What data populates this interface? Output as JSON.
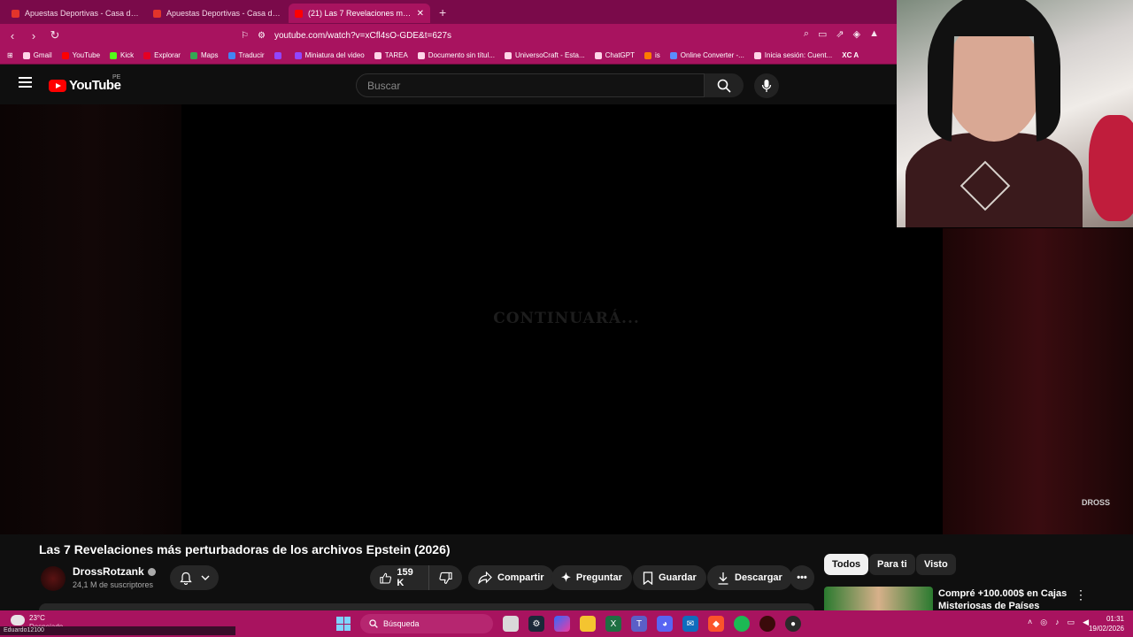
{
  "browser": {
    "tabs": [
      {
        "title": "Apuestas Deportivas - Casa de Apuestas",
        "active": false
      },
      {
        "title": "Apuestas Deportivas - Casa de Apuestas",
        "active": false
      },
      {
        "title": "(21) Las 7 Revelaciones más perturbadoras",
        "active": true
      }
    ],
    "url": "youtube.com/watch?v=xCfl4sO-GDE&t=627s",
    "bookmarks": [
      "Gmail",
      "YouTube",
      "Kick",
      "Explorar",
      "Maps",
      "Traducir",
      "",
      "Miniatura del video",
      "TAREA",
      "Documento sin títul...",
      "UniversoCraft - Esta...",
      "ChatGPT",
      "is",
      "Online Converter -...",
      "Inicia sesión: Cuent...",
      "XC A"
    ]
  },
  "youtube": {
    "logo_text": "YouTube",
    "country_code": "PE",
    "search_placeholder": "Buscar"
  },
  "player": {
    "overlay_text": "CONTINUARÁ...",
    "watermark": "DROSS"
  },
  "video": {
    "title": "Las 7 Revelaciones más perturbadoras de los archivos Epstein (2026)",
    "channel": "DrossRotzank",
    "subscribers": "24,1 M de suscriptores",
    "likes": "159 K",
    "share_label": "Compartir",
    "ask_label": "Preguntar",
    "save_label": "Guardar",
    "download_label": "Descargar"
  },
  "chips": [
    "Todos",
    "Para ti",
    "Visto"
  ],
  "recommendation": {
    "title": "Compré +100.000$ en Cajas Misteriosas de Países"
  },
  "taskbar": {
    "temperature": "23°C",
    "weather_text": "Despejado",
    "search_label": "Búsqueda",
    "time": "01:31",
    "date": "19/02/2026"
  },
  "stream_overlay": {
    "user": "Eduardo12100"
  },
  "colors": {
    "accent": "#a8135f",
    "youtube_red": "#ff0000"
  }
}
